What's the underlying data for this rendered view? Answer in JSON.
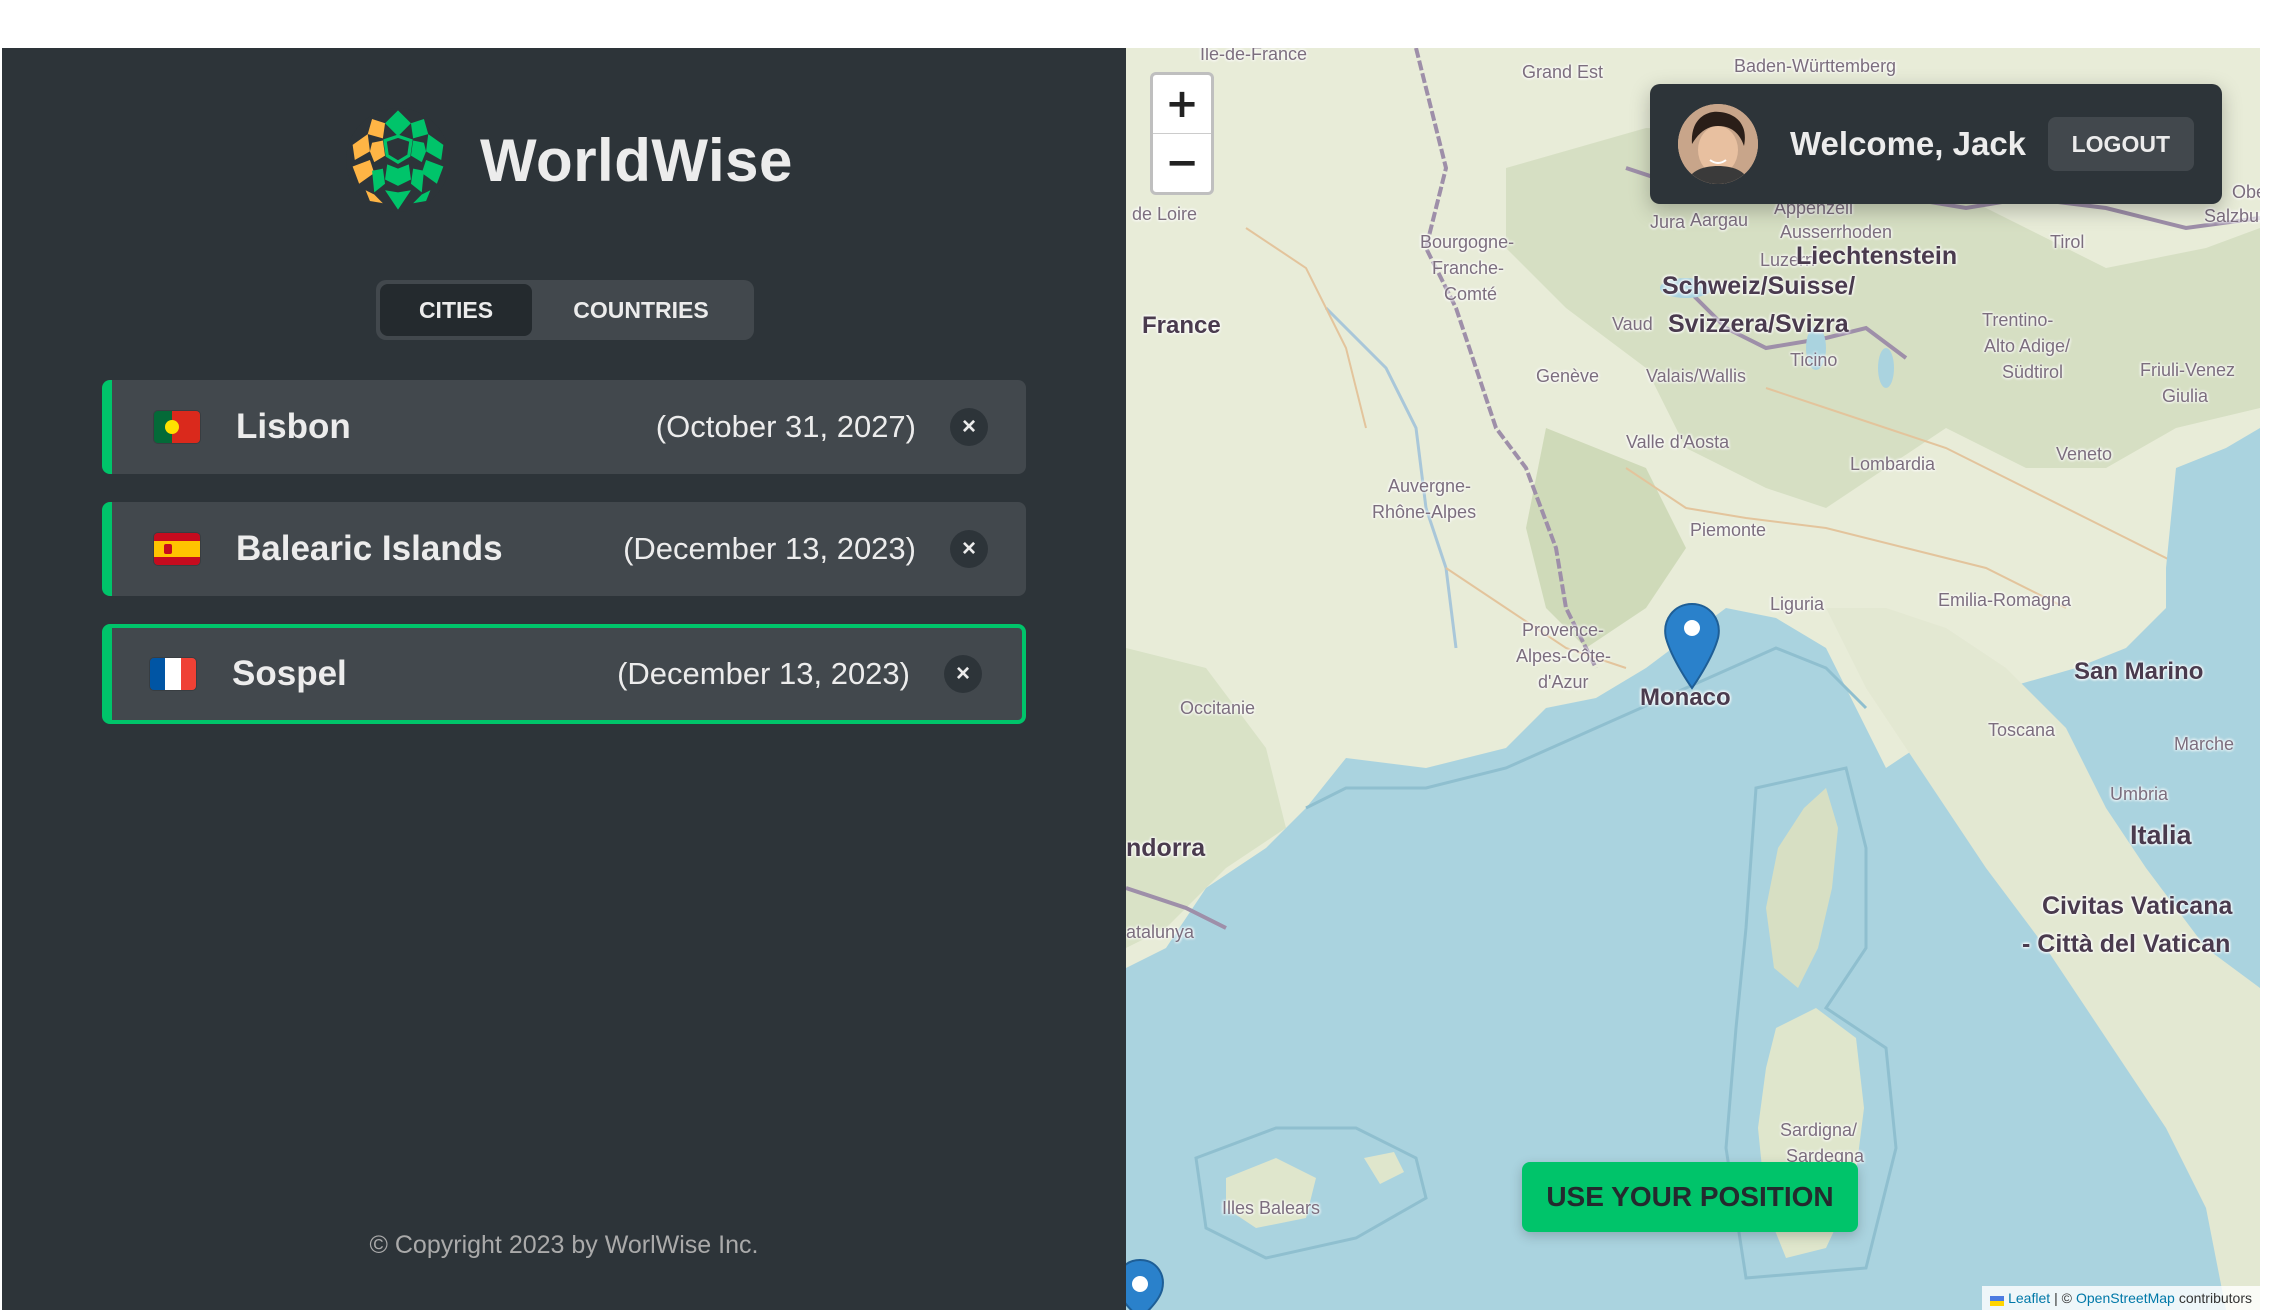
{
  "app": {
    "name": "WorldWise"
  },
  "tabs": [
    {
      "label": "Cities",
      "active": true
    },
    {
      "label": "Countries",
      "active": false
    }
  ],
  "cities": [
    {
      "flag": "portugal-flag",
      "name": "Lisbon",
      "date": "(October 31, 2027)",
      "active": false
    },
    {
      "flag": "spain-flag",
      "name": "Balearic Islands",
      "date": "(December 13, 2023)",
      "active": false
    },
    {
      "flag": "france-flag",
      "name": "Sospel",
      "date": "(December 13, 2023)",
      "active": true
    }
  ],
  "delete_label": "×",
  "copyright": "© Copyright 2023 by WorlWise Inc.",
  "map": {
    "zoom_in": "+",
    "zoom_out": "−",
    "user": {
      "welcome": "Welcome, Jack",
      "logout": "Logout"
    },
    "use_position": "Use your position",
    "attribution": {
      "leaflet": "Leaflet",
      "separator": " | © ",
      "osm": "OpenStreetMap",
      "suffix": " contributors"
    },
    "marker_label": "Monaco",
    "labels": {
      "ile_de_france": "Île-de-France",
      "grand_est": "Grand Est",
      "baden": "Baden-Württemberg",
      "centre_loire": "de Loire",
      "bourgogne": "Bourgogne-",
      "franche_comte": "Franche-",
      "comte": "Comté",
      "france": "France",
      "aargau": "Aargau",
      "liechtenstein": "Liechtenstein",
      "schweiz": "Schweiz/Suisse/",
      "svizzera": "Svizzera/Svizra",
      "vaud": "Vaud",
      "ticino": "Ticino",
      "trentino": "Trentino-",
      "alto_adige": "Alto Adige/",
      "sudtirol": "Südtirol",
      "friuli": "Friuli-Venez",
      "giulia": "Giulia",
      "geneve": "Genève",
      "valais": "Valais/Wallis",
      "valle_aosta": "Valle d'Aosta",
      "lombardia": "Lombardia",
      "veneto": "Veneto",
      "auvergne": "Auvergne-",
      "rhone_alpes": "Rhône-Alpes",
      "piemonte": "Piemonte",
      "liguria": "Liguria",
      "emilia": "Emilia-Romagna",
      "provence": "Provence-",
      "alpes_cote": "Alpes-Côte-",
      "dazur": "d'Azur",
      "occitanie": "Occitanie",
      "san_marino": "San Marino",
      "toscana": "Toscana",
      "marche": "Marche",
      "umbria": "Umbria",
      "italia": "Italia",
      "andorra": "ndorra",
      "catalunya": "atalunya",
      "civitas": "Civitas Vaticana",
      "citta": "- Città del Vatican",
      "sardigna": "Sardigna/",
      "sardegna": "Sardegna",
      "illes_balears": "Illes Balears",
      "tirol": "Tirol",
      "salzburg": "Salzbur",
      "ober": "Obe",
      "luzern": "Luzern",
      "appenzell": "Appenzell",
      "ausserrhoden": "Ausserrhoden",
      "jura": "Jura"
    }
  }
}
